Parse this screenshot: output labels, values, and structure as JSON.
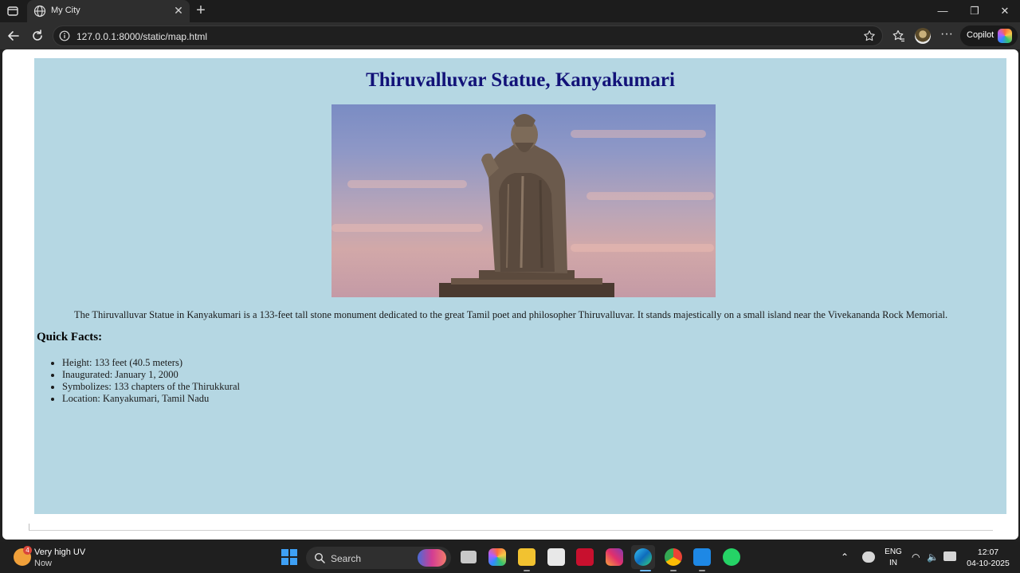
{
  "browser": {
    "tab_title": "My City",
    "url": "127.0.0.1:8000/static/map.html",
    "copilot_label": "Copilot"
  },
  "page": {
    "heading": "Thiruvalluvar Statue, Kanyakumari",
    "description": "The Thiruvalluvar Statue in Kanyakumari is a 133-feet tall stone monument dedicated to the great Tamil poet and philosopher Thiruvalluvar. It stands majestically on a small island near the Vivekananda Rock Memorial.",
    "quick_facts_title": "Quick Facts:",
    "facts": [
      "Height: 133 feet (40.5 meters)",
      "Inaugurated: January 1, 2000",
      "Symbolizes: 133 chapters of the Thirukkural",
      "Location: Kanyakumari, Tamil Nadu"
    ],
    "background_color": "#b5d7e3",
    "heading_color": "#121278"
  },
  "taskbar": {
    "weather_title": "Very high UV",
    "weather_sub": "Now",
    "weather_badge": "4",
    "search_label": "Search",
    "lang_top": "ENG",
    "lang_bottom": "IN",
    "time": "12:07",
    "date": "04-10-2025"
  }
}
